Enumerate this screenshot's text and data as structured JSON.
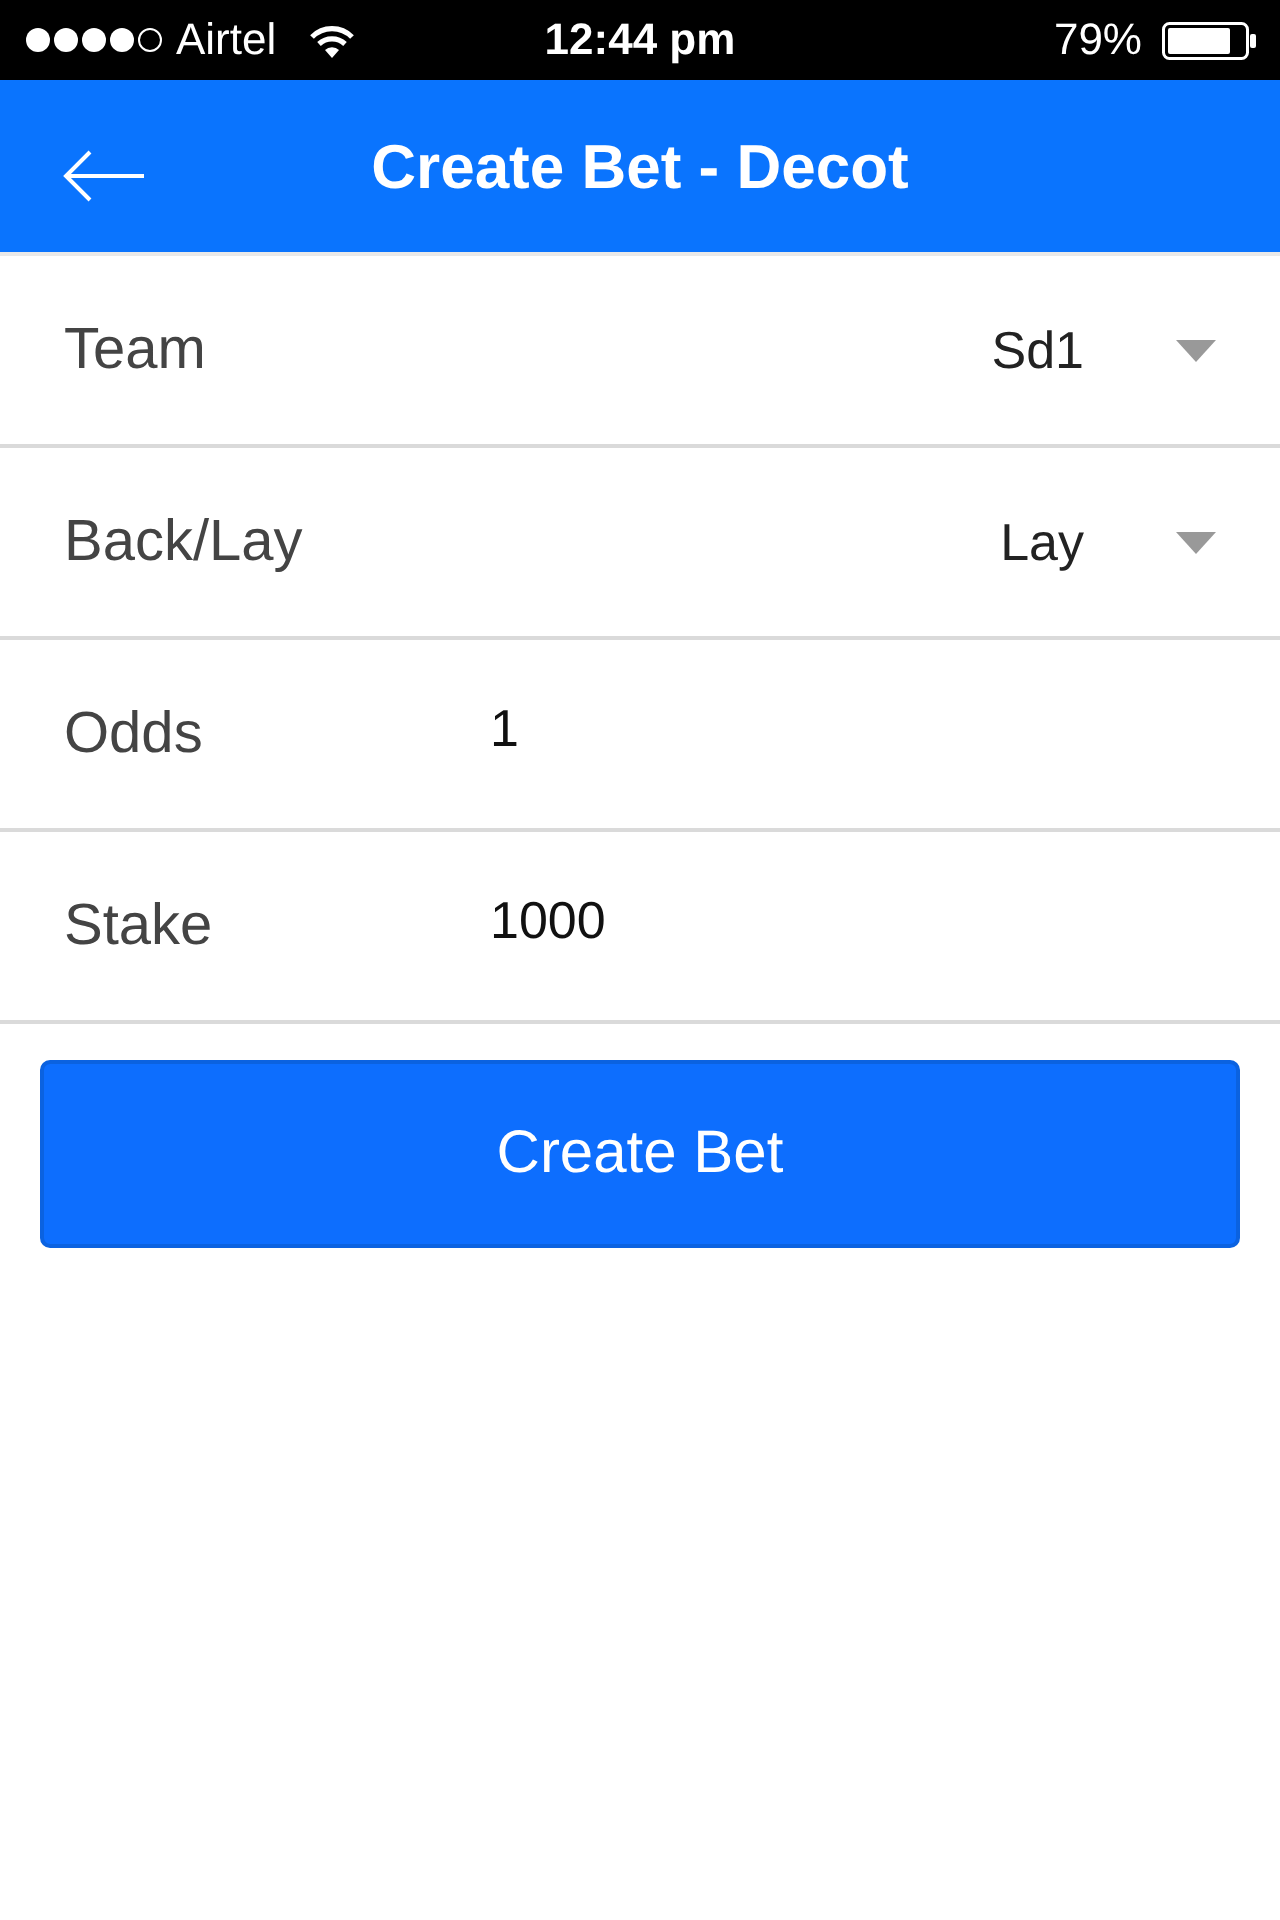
{
  "status_bar": {
    "carrier": "Airtel",
    "time": "12:44 pm",
    "battery": "79%"
  },
  "header": {
    "title": "Create Bet - Decot"
  },
  "form": {
    "rows": [
      {
        "kind": "select",
        "label": "Team",
        "value": "Sd1"
      },
      {
        "kind": "select",
        "label": "Back/Lay",
        "value": "Lay"
      },
      {
        "kind": "input",
        "label": "Odds",
        "value": "1"
      },
      {
        "kind": "input",
        "label": "Stake",
        "value": "1000"
      }
    ]
  },
  "button": {
    "label": "Create Bet"
  }
}
